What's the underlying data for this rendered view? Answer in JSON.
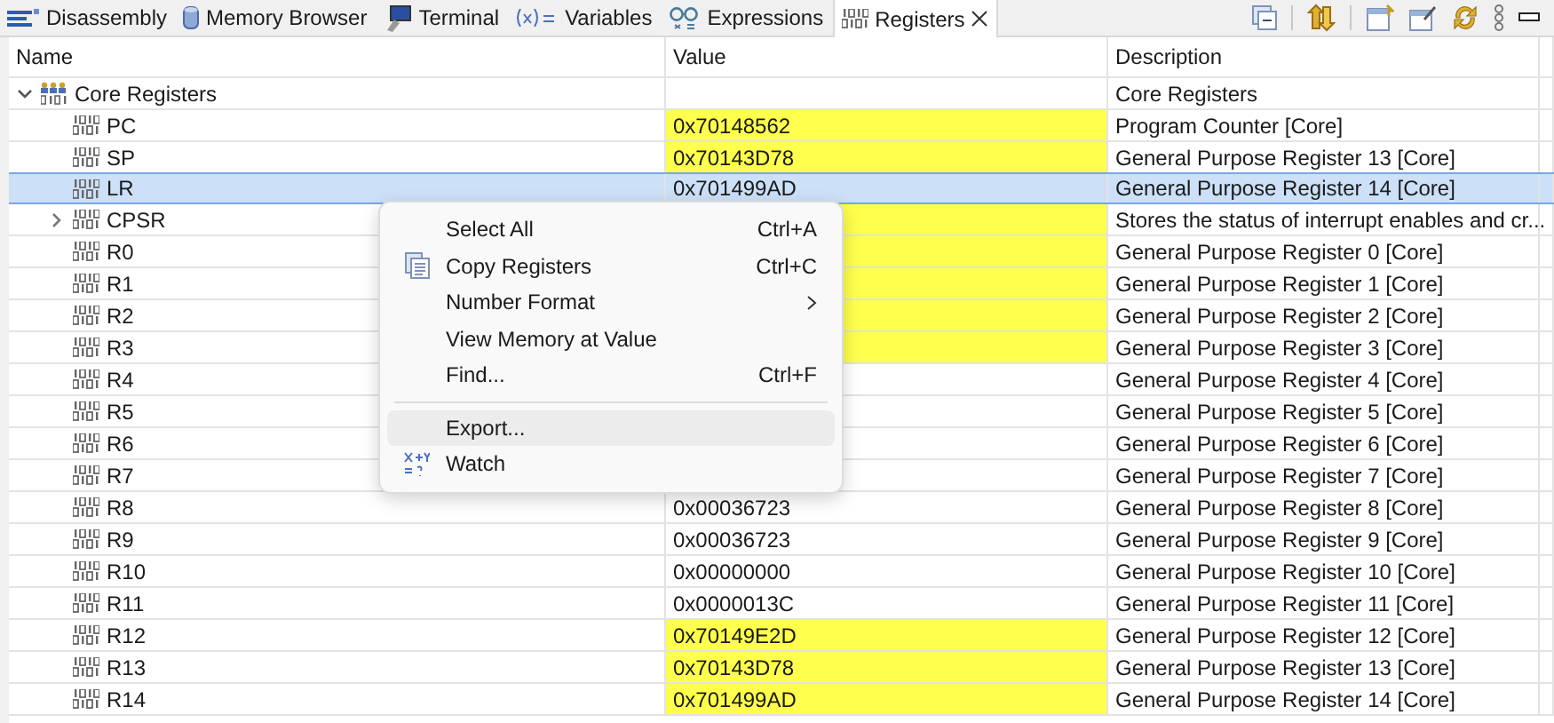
{
  "tabs": [
    {
      "label": "Disassembly",
      "selected": false
    },
    {
      "label": "Memory Browser",
      "selected": false
    },
    {
      "label": "Terminal",
      "selected": false
    },
    {
      "label": "Variables",
      "selected": false
    },
    {
      "label": "Expressions",
      "selected": false
    },
    {
      "label": "Registers",
      "selected": true
    }
  ],
  "table": {
    "columns": [
      "Name",
      "Value",
      "Description"
    ],
    "rows": [
      {
        "name": "Core Registers",
        "kind": "expanded",
        "selected": false,
        "description": "Core Registers",
        "children": [
          {
            "name": "PC",
            "kind": "leaf",
            "selected": false,
            "value": "0x70148562",
            "changed": true,
            "description": "Program Counter [Core]"
          },
          {
            "name": "SP",
            "kind": "leaf",
            "selected": false,
            "value": "0x70143D78",
            "changed": true,
            "description": "General Purpose Register 13 [Core]"
          },
          {
            "name": "LR",
            "kind": "leaf",
            "selected": true,
            "value": "0x701499AD",
            "changed": false,
            "description": "General Purpose Register 14 [Core]"
          },
          {
            "name": "CPSR",
            "kind": "collapsed",
            "selected": false,
            "changed": true,
            "description": "Stores the status of interrupt enables and cr..."
          },
          {
            "name": "R0",
            "kind": "leaf",
            "selected": false,
            "changed": true,
            "description": "General Purpose Register 0 [Core]"
          },
          {
            "name": "R1",
            "kind": "leaf",
            "selected": false,
            "changed": true,
            "description": "General Purpose Register 1 [Core]"
          },
          {
            "name": "R2",
            "kind": "leaf",
            "selected": false,
            "changed": true,
            "description": "General Purpose Register 2 [Core]"
          },
          {
            "name": "R3",
            "kind": "leaf",
            "selected": false,
            "changed": true,
            "description": "General Purpose Register 3 [Core]"
          },
          {
            "name": "R4",
            "kind": "leaf",
            "selected": false,
            "changed": false,
            "description": "General Purpose Register 4 [Core]"
          },
          {
            "name": "R5",
            "kind": "leaf",
            "selected": false,
            "changed": false,
            "description": "General Purpose Register 5 [Core]"
          },
          {
            "name": "R6",
            "kind": "leaf",
            "selected": false,
            "changed": false,
            "description": "General Purpose Register 6 [Core]"
          },
          {
            "name": "R7",
            "kind": "leaf",
            "selected": false,
            "changed": false,
            "description": "General Purpose Register 7 [Core]"
          },
          {
            "name": "R8",
            "kind": "leaf",
            "selected": false,
            "value": "0x00036723",
            "changed": false,
            "description": "General Purpose Register 8 [Core]"
          },
          {
            "name": "R9",
            "kind": "leaf",
            "selected": false,
            "value": "0x00036723",
            "changed": false,
            "description": "General Purpose Register 9 [Core]"
          },
          {
            "name": "R10",
            "kind": "leaf",
            "selected": false,
            "value": "0x00000000",
            "changed": false,
            "description": "General Purpose Register 10 [Core]"
          },
          {
            "name": "R11",
            "kind": "leaf",
            "selected": false,
            "value": "0x0000013C",
            "changed": false,
            "description": "General Purpose Register 11 [Core]"
          },
          {
            "name": "R12",
            "kind": "leaf",
            "selected": false,
            "value": "0x70149E2D",
            "changed": true,
            "description": "General Purpose Register 12 [Core]"
          },
          {
            "name": "R13",
            "kind": "leaf",
            "selected": false,
            "value": "0x70143D78",
            "changed": true,
            "description": "General Purpose Register 13 [Core]"
          },
          {
            "name": "R14",
            "kind": "leaf",
            "selected": false,
            "value": "0x701499AD",
            "changed": true,
            "description": "General Purpose Register 14 [Core]"
          }
        ]
      }
    ]
  },
  "context_menu": [
    {
      "kind": "item",
      "label": "Select All",
      "shortcut": "Ctrl+A",
      "selected": false
    },
    {
      "kind": "item",
      "label": "Copy Registers",
      "shortcut": "Ctrl+C",
      "selected": false
    },
    {
      "kind": "submenu",
      "label": "Number Format",
      "selected": false
    },
    {
      "kind": "item",
      "label": "View Memory at Value",
      "selected": false
    },
    {
      "kind": "item",
      "label": "Find...",
      "shortcut": "Ctrl+F",
      "selected": false
    },
    {
      "kind": "separator"
    },
    {
      "kind": "item",
      "label": "Export...",
      "selected": true
    },
    {
      "kind": "item",
      "label": "Watch",
      "selected": false
    }
  ]
}
